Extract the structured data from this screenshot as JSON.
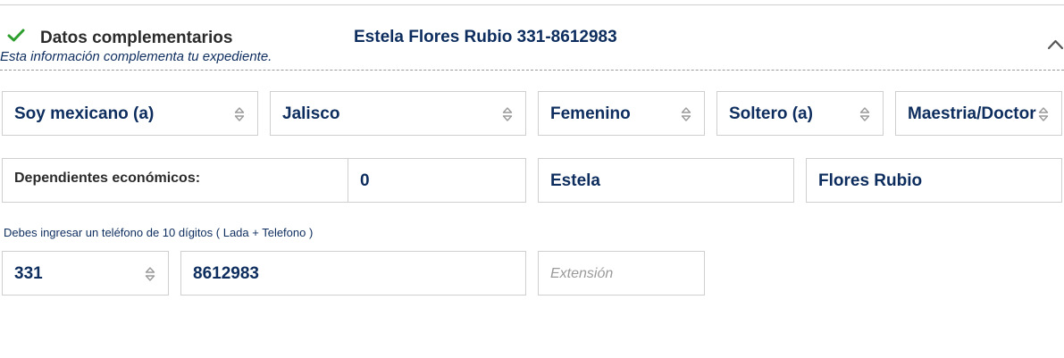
{
  "section": {
    "title": "Datos complementarios",
    "subtitle": "Esta información complementa tu expediente.",
    "person_summary": "Estela Flores Rubio 331-8612983",
    "icons": {
      "status": "check-icon",
      "toggle": "chevron-up-icon",
      "select": "sort-icon"
    },
    "colors": {
      "check": "#2e9e2e",
      "accent_text": "#0d2d5e",
      "border": "#cfcfcf"
    }
  },
  "row1": {
    "nationality": "Soy mexicano (a)",
    "state": "Jalisco",
    "gender": "Femenino",
    "marital_status": "Soltero (a)",
    "education": "Maestria/Doctorado"
  },
  "row2": {
    "dependents_label": "Dependientes económicos:",
    "dependents_value": "0",
    "first_name": "Estela",
    "last_names": "Flores Rubio"
  },
  "phone": {
    "hint": "Debes ingresar un teléfono de 10 dígitos ( Lada + Telefono )",
    "area_code": "331",
    "number": "8612983",
    "extension_placeholder": "Extensión",
    "extension_value": ""
  }
}
